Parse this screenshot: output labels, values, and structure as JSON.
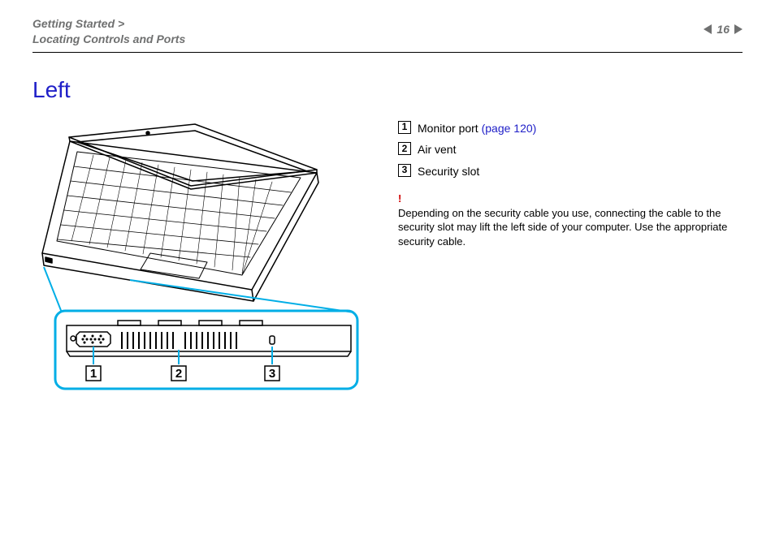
{
  "breadcrumb": {
    "line1": "Getting Started >",
    "line2": "Locating Controls and Ports"
  },
  "page_number": "16",
  "title": "Left",
  "legend": {
    "items": [
      {
        "n": "1",
        "text": "Monitor port",
        "link": "(page 120)"
      },
      {
        "n": "2",
        "text": "Air vent",
        "link": ""
      },
      {
        "n": "3",
        "text": "Security slot",
        "link": ""
      }
    ],
    "warning_mark": "!",
    "warning_text": "Depending on the security cable you use, connecting the cable to the security slot may lift the left side of your computer. Use the appropriate security cable."
  },
  "callouts": {
    "c1": "1",
    "c2": "2",
    "c3": "3"
  }
}
